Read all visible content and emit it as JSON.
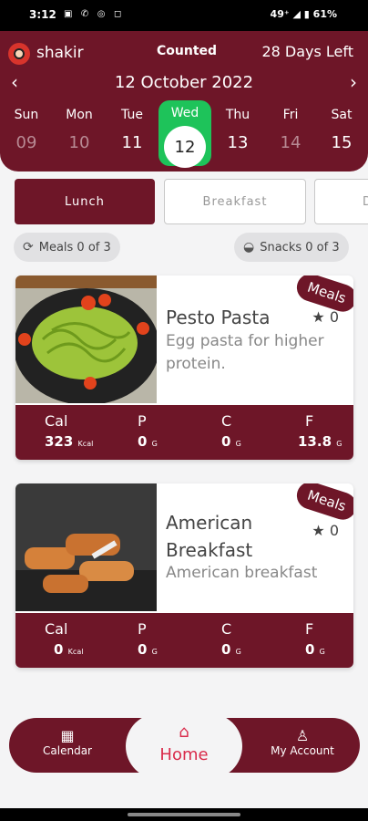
{
  "status_bar": {
    "time": "3:12",
    "right": "49⁺ ◢ ▮ 61%"
  },
  "header": {
    "username": "shakir",
    "counted": "Counted",
    "days_left": "28 Days Left",
    "date": "12 October 2022"
  },
  "days": [
    {
      "name": "Sun",
      "num": "09"
    },
    {
      "name": "Mon",
      "num": "10"
    },
    {
      "name": "Tue",
      "num": "11"
    },
    {
      "name": "Wed",
      "num": "12"
    },
    {
      "name": "Thu",
      "num": "13"
    },
    {
      "name": "Fri",
      "num": "14"
    },
    {
      "name": "Sat",
      "num": "15"
    }
  ],
  "tabs": {
    "lunch": "Lunch",
    "breakfast": "Breakfast",
    "partial": "D"
  },
  "pills": {
    "meals": "Meals 0 of 3",
    "snacks": "Snacks 0 of 3"
  },
  "meals": [
    {
      "title": "Pesto Pasta",
      "desc_line1": "Egg pasta for higher",
      "desc_line2": "protein.",
      "badge": "Meals",
      "rating": "★ 0",
      "cal": "323",
      "cal_unit": "Kcal",
      "p": "0",
      "c": "0",
      "f": "13.8",
      "g_unit": "G"
    },
    {
      "title_line1": "American",
      "title_line2": "Breakfast",
      "desc": "American breakfast",
      "badge": "Meals",
      "rating": "★ 0",
      "cal": "0",
      "cal_unit": "Kcal",
      "p": "0",
      "c": "0",
      "f": "0",
      "g_unit": "G"
    }
  ],
  "labels": {
    "cal": "Cal",
    "p": "P",
    "c": "C",
    "f": "F"
  },
  "nav": {
    "calendar": "Calendar",
    "home": "Home",
    "account": "My Account"
  },
  "colors": {
    "brand": "#6e1628",
    "selected_day": "#1ec35a",
    "home_active": "#d92b4b"
  }
}
